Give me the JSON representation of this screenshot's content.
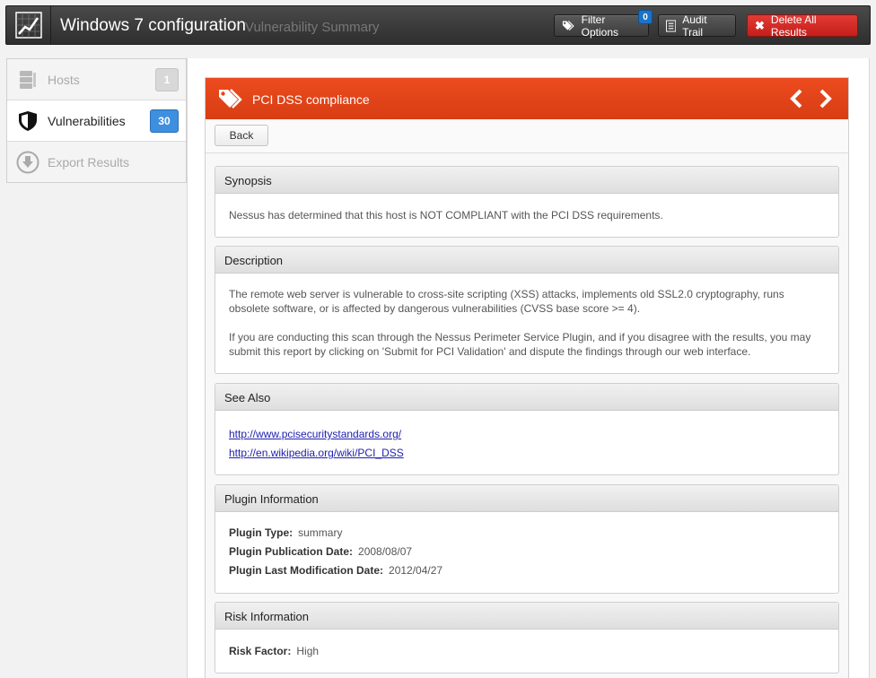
{
  "header": {
    "title": "Windows 7 configuration",
    "subtitle": "Vulnerability Summary",
    "filter_label": "Filter Options",
    "filter_count": "0",
    "audit_label": "Audit Trail",
    "delete_label": "Delete All Results"
  },
  "sidebar": {
    "items": [
      {
        "label": "Hosts",
        "count": "1",
        "icon": "server-icon"
      },
      {
        "label": "Vulnerabilities",
        "count": "30",
        "icon": "shield-icon"
      },
      {
        "label": "Export Results",
        "icon": "download-icon"
      }
    ]
  },
  "panel": {
    "title": "PCI DSS compliance",
    "back_label": "Back"
  },
  "sections": {
    "synopsis": {
      "title": "Synopsis",
      "text": "Nessus has determined that this host is NOT COMPLIANT with the PCI DSS requirements."
    },
    "description": {
      "title": "Description",
      "para1": "The remote web server is vulnerable to cross-site scripting (XSS) attacks, implements old SSL2.0 cryptography, runs obsolete software, or is affected by dangerous vulnerabilities (CVSS base score >= 4).",
      "para2": "If you are conducting this scan through the Nessus Perimeter Service Plugin, and if you disagree with the results, you may submit this report by clicking on 'Submit for PCI Validation' and dispute the findings through our web interface."
    },
    "see_also": {
      "title": "See Also",
      "links": [
        "http://www.pcisecuritystandards.org/",
        "http://en.wikipedia.org/wiki/PCI_DSS"
      ]
    },
    "plugin": {
      "title": "Plugin Information",
      "type_label": "Plugin Type:",
      "type_value": "summary",
      "pub_label": "Plugin Publication Date:",
      "pub_value": "2008/08/07",
      "mod_label": "Plugin Last Modification Date:",
      "mod_value": "2012/04/27"
    },
    "risk": {
      "title": "Risk Information",
      "factor_label": "Risk Factor:",
      "factor_value": "High"
    }
  },
  "colors": {
    "accent_orange": "#e4451a",
    "danger_red": "#d42a25",
    "count_blue": "#3f8fdf"
  }
}
